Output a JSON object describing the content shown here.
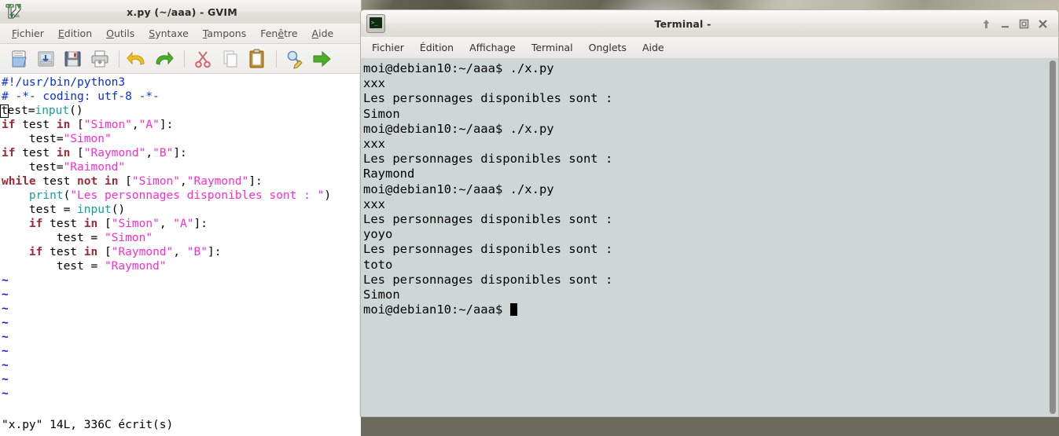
{
  "gvim": {
    "title": "x.py (~/aaa) - GVIM",
    "icon": "vim-logo-icon",
    "menus": [
      {
        "pre": "",
        "mnemonic": "F",
        "post": "ichier",
        "name": "menu-fichier"
      },
      {
        "pre": "",
        "mnemonic": "E",
        "post": "dition",
        "name": "menu-edition"
      },
      {
        "pre": "",
        "mnemonic": "O",
        "post": "utils",
        "name": "menu-outils"
      },
      {
        "pre": "",
        "mnemonic": "S",
        "post": "yntaxe",
        "name": "menu-syntaxe"
      },
      {
        "pre": "",
        "mnemonic": "T",
        "post": "ampons",
        "name": "menu-tampons"
      },
      {
        "pre": "Fen",
        "mnemonic": "ê",
        "post": "tre",
        "name": "menu-fenetre"
      },
      {
        "pre": "",
        "mnemonic": "A",
        "post": "ide",
        "name": "menu-aide"
      }
    ],
    "toolbar": [
      {
        "name": "open-file-icon",
        "label": "Ouvrir"
      },
      {
        "name": "open-remote-icon",
        "label": "Ouvrir distant"
      },
      {
        "name": "save-file-icon",
        "label": "Enregistrer"
      },
      {
        "name": "print-icon",
        "label": "Imprimer"
      },
      {
        "name": "undo-icon",
        "label": "Annuler"
      },
      {
        "name": "redo-icon",
        "label": "Refaire"
      },
      {
        "name": "cut-icon",
        "label": "Couper"
      },
      {
        "name": "copy-icon",
        "label": "Copier"
      },
      {
        "name": "paste-icon",
        "label": "Coller"
      },
      {
        "name": "find-replace-icon",
        "label": "Rechercher"
      },
      {
        "name": "run-icon",
        "label": "Exécuter"
      }
    ],
    "code_lines": [
      [
        {
          "t": "#!/usr/bin/python3",
          "c": "comment"
        }
      ],
      [
        {
          "t": "# -*- coding: utf-8 -*-",
          "c": "comment"
        }
      ],
      [
        {
          "t": "t",
          "c": "cursor"
        },
        {
          "t": "est=",
          "c": "plain"
        },
        {
          "t": "input",
          "c": "fn"
        },
        {
          "t": "()",
          "c": "plain"
        }
      ],
      [
        {
          "t": "if",
          "c": "kw"
        },
        {
          "t": " test ",
          "c": "plain"
        },
        {
          "t": "in",
          "c": "kw"
        },
        {
          "t": " [",
          "c": "plain"
        },
        {
          "t": "\"Simon\"",
          "c": "str"
        },
        {
          "t": ",",
          "c": "plain"
        },
        {
          "t": "\"A\"",
          "c": "str"
        },
        {
          "t": "]:",
          "c": "plain"
        }
      ],
      [
        {
          "t": "    test=",
          "c": "plain"
        },
        {
          "t": "\"Simon\"",
          "c": "str"
        }
      ],
      [
        {
          "t": "if",
          "c": "kw"
        },
        {
          "t": " test ",
          "c": "plain"
        },
        {
          "t": "in",
          "c": "kw"
        },
        {
          "t": " [",
          "c": "plain"
        },
        {
          "t": "\"Raymond\"",
          "c": "str"
        },
        {
          "t": ",",
          "c": "plain"
        },
        {
          "t": "\"B\"",
          "c": "str"
        },
        {
          "t": "]:",
          "c": "plain"
        }
      ],
      [
        {
          "t": "    test=",
          "c": "plain"
        },
        {
          "t": "\"Raimond\"",
          "c": "str"
        }
      ],
      [
        {
          "t": "while",
          "c": "kw"
        },
        {
          "t": " test ",
          "c": "plain"
        },
        {
          "t": "not in",
          "c": "kw"
        },
        {
          "t": " [",
          "c": "plain"
        },
        {
          "t": "\"Simon\"",
          "c": "str"
        },
        {
          "t": ",",
          "c": "plain"
        },
        {
          "t": "\"Raymond\"",
          "c": "str"
        },
        {
          "t": "]:",
          "c": "plain"
        }
      ],
      [
        {
          "t": "    ",
          "c": "plain"
        },
        {
          "t": "print",
          "c": "fn"
        },
        {
          "t": "(",
          "c": "plain"
        },
        {
          "t": "\"Les personnages disponibles sont : \"",
          "c": "str"
        },
        {
          "t": ")",
          "c": "plain"
        }
      ],
      [
        {
          "t": "    test = ",
          "c": "plain"
        },
        {
          "t": "input",
          "c": "fn"
        },
        {
          "t": "()",
          "c": "plain"
        }
      ],
      [
        {
          "t": "    ",
          "c": "plain"
        },
        {
          "t": "if",
          "c": "kw"
        },
        {
          "t": " test ",
          "c": "plain"
        },
        {
          "t": "in",
          "c": "kw"
        },
        {
          "t": " [",
          "c": "plain"
        },
        {
          "t": "\"Simon\"",
          "c": "str"
        },
        {
          "t": ", ",
          "c": "plain"
        },
        {
          "t": "\"A\"",
          "c": "str"
        },
        {
          "t": "]:",
          "c": "plain"
        }
      ],
      [
        {
          "t": "        test = ",
          "c": "plain"
        },
        {
          "t": "\"Simon\"",
          "c": "str"
        }
      ],
      [
        {
          "t": "    ",
          "c": "plain"
        },
        {
          "t": "if",
          "c": "kw"
        },
        {
          "t": " test ",
          "c": "plain"
        },
        {
          "t": "in",
          "c": "kw"
        },
        {
          "t": " [",
          "c": "plain"
        },
        {
          "t": "\"Raymond\"",
          "c": "str"
        },
        {
          "t": ", ",
          "c": "plain"
        },
        {
          "t": "\"B\"",
          "c": "str"
        },
        {
          "t": "]:",
          "c": "plain"
        }
      ],
      [
        {
          "t": "        test = ",
          "c": "plain"
        },
        {
          "t": "\"Raymond\"",
          "c": "str"
        }
      ],
      [
        {
          "t": "~",
          "c": "tilde"
        }
      ],
      [
        {
          "t": "~",
          "c": "tilde"
        }
      ],
      [
        {
          "t": "~",
          "c": "tilde"
        }
      ],
      [
        {
          "t": "~",
          "c": "tilde"
        }
      ],
      [
        {
          "t": "~",
          "c": "tilde"
        }
      ],
      [
        {
          "t": "~",
          "c": "tilde"
        }
      ],
      [
        {
          "t": "~",
          "c": "tilde"
        }
      ],
      [
        {
          "t": "~",
          "c": "tilde"
        }
      ],
      [
        {
          "t": "~",
          "c": "tilde"
        }
      ]
    ],
    "status": "\"x.py\" 14L, 336C écrit(s)"
  },
  "terminal": {
    "title": "Terminal -",
    "icon": "terminal-icon",
    "menus": [
      {
        "label": "Fichier",
        "name": "menu-fichier"
      },
      {
        "label": "Édition",
        "name": "menu-edition"
      },
      {
        "label": "Affichage",
        "name": "menu-affichage"
      },
      {
        "label": "Terminal",
        "name": "menu-terminal"
      },
      {
        "label": "Onglets",
        "name": "menu-onglets"
      },
      {
        "label": "Aide",
        "name": "menu-aide"
      }
    ],
    "window_buttons": [
      {
        "name": "shade-button",
        "glyph": "shade"
      },
      {
        "name": "minimize-button",
        "glyph": "minimize"
      },
      {
        "name": "maximize-button",
        "glyph": "maximize"
      },
      {
        "name": "close-button",
        "glyph": "close"
      }
    ],
    "lines": [
      "moi@debian10:~/aaa$ ./x.py",
      "xxx",
      "Les personnages disponibles sont :",
      "Simon",
      "moi@debian10:~/aaa$ ./x.py",
      "xxx",
      "Les personnages disponibles sont :",
      "Raymond",
      "moi@debian10:~/aaa$ ./x.py",
      "xxx",
      "Les personnages disponibles sont :",
      "yoyo",
      "Les personnages disponibles sont :",
      "toto",
      "Les personnages disponibles sont :",
      "Simon"
    ],
    "prompt": "moi@debian10:~/aaa$ ",
    "background": "#cfd6d6",
    "foreground": "#000000"
  }
}
